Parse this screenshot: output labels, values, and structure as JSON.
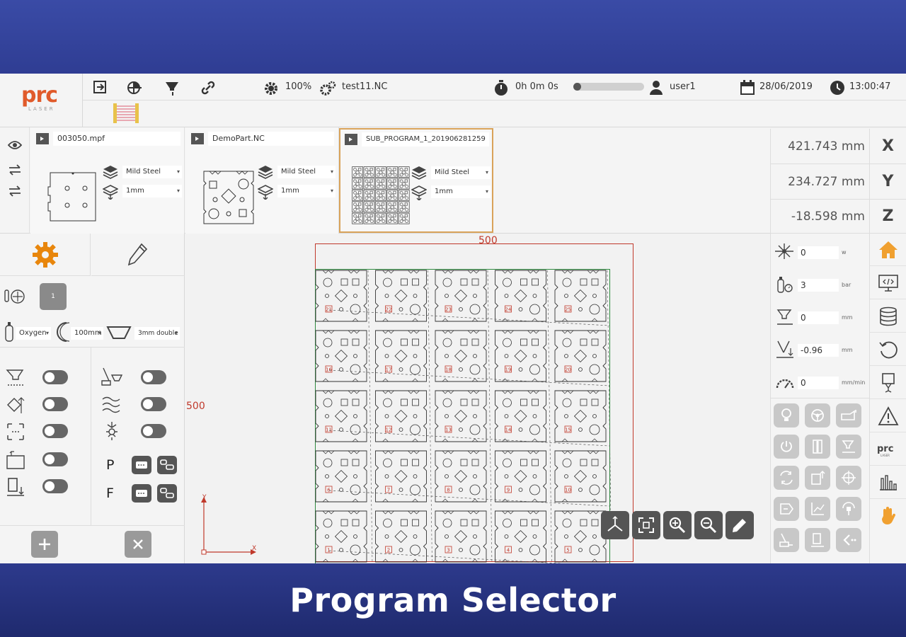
{
  "caption": "Program Selector",
  "header": {
    "logo_text": "prc",
    "logo_sub": "LASER",
    "power": "100%",
    "nc_file": "test11.NC",
    "timer": "0h 0m 0s",
    "progress": 0.0,
    "user": "user1",
    "date": "28/06/2019",
    "time": "13:00:47"
  },
  "programs": [
    {
      "name": "003050.mpf",
      "material": "Mild Steel",
      "thickness": "1mm"
    },
    {
      "name": "DemoPart.NC",
      "material": "Mild Steel",
      "thickness": "1mm"
    },
    {
      "name": "SUB_PROGRAM_1_201906281259",
      "material": "Mild Steel",
      "thickness": "1mm",
      "selected": true
    }
  ],
  "coords": {
    "x": "421.743 mm",
    "y": "234.727 mm",
    "z": "-18.598 mm"
  },
  "axis_labels": {
    "x": "X",
    "y": "Y",
    "z": "Z"
  },
  "left": {
    "nozzle_count": "1",
    "gas": "Oxygen",
    "focal": "100mm",
    "nozzle": "3mm double",
    "p_label": "P",
    "f_label": "F"
  },
  "canvas": {
    "dim_top": "500",
    "dim_left": "500",
    "axis_y": "Y",
    "axis_x": "X",
    "part_numbers": [
      "21",
      "22",
      "23",
      "24",
      "25",
      "16",
      "17",
      "18",
      "19",
      "20",
      "11",
      "12",
      "13",
      "14",
      "15",
      "6",
      "7",
      "8",
      "9",
      "10",
      "1",
      "2",
      "3",
      "4",
      "5"
    ]
  },
  "params": [
    {
      "value": "0",
      "unit": "w"
    },
    {
      "value": "3",
      "unit": "bar"
    },
    {
      "value": "0",
      "unit": "mm"
    },
    {
      "value": "-0.96",
      "unit": "mm"
    },
    {
      "value": "0",
      "unit": "mm/min"
    }
  ],
  "colors": {
    "accent": "#e8860c",
    "selected_border": "#d9a35a",
    "dim_red": "#c0392b",
    "home_orange": "#f0a030"
  }
}
